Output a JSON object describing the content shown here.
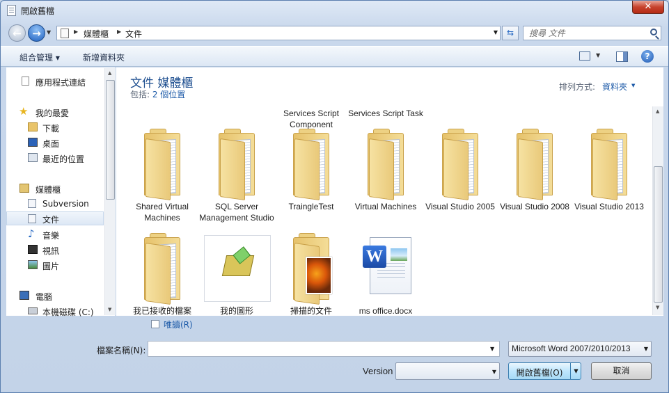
{
  "window": {
    "title": "開啟舊檔",
    "close_glyph": "✕"
  },
  "address": {
    "crumbs": [
      "媒體櫃",
      "文件"
    ],
    "search_placeholder": "搜尋 文件"
  },
  "toolbar": {
    "organize": "組合管理 ▾",
    "new_folder": "新增資料夾",
    "help": "?"
  },
  "nav": {
    "items": [
      {
        "label": "應用程式連結",
        "icon": "link-icon"
      },
      {
        "label": "我的最愛",
        "icon": "star-icon"
      },
      {
        "label": "下載",
        "icon": "download-icon"
      },
      {
        "label": "桌面",
        "icon": "desktop-icon"
      },
      {
        "label": "最近的位置",
        "icon": "recent-places-icon"
      },
      {
        "label": "媒體櫃",
        "icon": "library-icon"
      },
      {
        "label": "Subversion",
        "icon": "document-icon"
      },
      {
        "label": "文件",
        "icon": "document-icon",
        "selected": true
      },
      {
        "label": "音樂",
        "icon": "music-icon"
      },
      {
        "label": "視訊",
        "icon": "video-icon"
      },
      {
        "label": "圖片",
        "icon": "picture-icon"
      },
      {
        "label": "電腦",
        "icon": "computer-icon"
      },
      {
        "label": "本機磁碟 (C:)",
        "icon": "drive-icon"
      }
    ]
  },
  "library": {
    "title": "文件 媒體櫃",
    "includes_prefix": "包括: ",
    "includes_link": "2 個位置",
    "arrange_label": "排列方式:",
    "arrange_value": "資料夾"
  },
  "files": {
    "above1": "Services Script Component",
    "above2": "Services Script Task",
    "items": [
      "Shared Virtual Machines",
      "SQL Server Management Studio",
      "TraingleTest",
      "Virtual Machines",
      "Visual Studio 2005",
      "Visual Studio 2008",
      "Visual Studio 2013",
      "我已接收的檔案",
      "我的圖形",
      "掃描的文件",
      "ms office.docx"
    ]
  },
  "bottom": {
    "readonly": "唯讀(R)",
    "filename_label": "檔案名稱(N):",
    "filename_value": "",
    "filetype_value": "Microsoft Word 2007/2010/2013",
    "version_label": "Version",
    "open": "開啟舊檔(O)",
    "cancel": "取消"
  }
}
